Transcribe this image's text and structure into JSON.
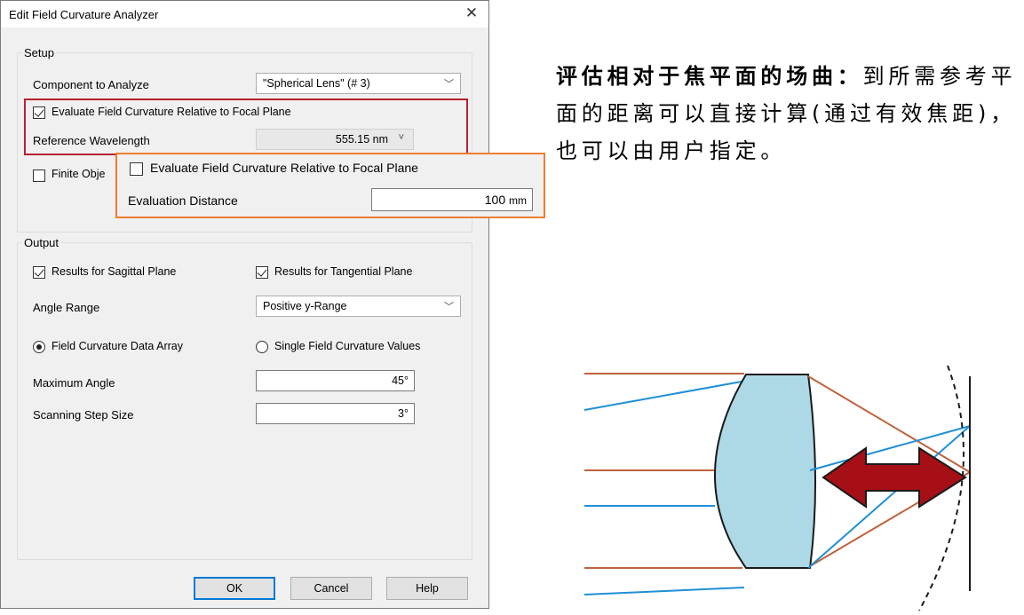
{
  "dialog": {
    "title": "Edit Field Curvature Analyzer",
    "close_glyph": "✕",
    "setup": {
      "legend": "Setup",
      "component_label": "Component to Analyze",
      "component_value": "\"Spherical Lens\" (# 3)",
      "eval_focal_label": "Evaluate Field Curvature Relative to Focal Plane",
      "eval_focal_checked": true,
      "ref_wavelength_label": "Reference Wavelength",
      "ref_wavelength_value": "555.15 nm",
      "finite_label": "Finite Obje",
      "finite_checked": false
    },
    "popup": {
      "eval_focal_label": "Evaluate Field Curvature Relative to Focal Plane",
      "eval_focal_checked": false,
      "distance_label": "Evaluation Distance",
      "distance_value": "100",
      "distance_unit": "mm"
    },
    "output": {
      "legend": "Output",
      "sagittal_label": "Results for Sagittal Plane",
      "sagittal_checked": true,
      "tangential_label": "Results for Tangential Plane",
      "tangential_checked": true,
      "angle_range_label": "Angle Range",
      "angle_range_value": "Positive y-Range",
      "data_array_label": "Field Curvature Data Array",
      "data_array_selected": true,
      "single_values_label": "Single Field Curvature Values",
      "single_values_selected": false,
      "max_angle_label": "Maximum Angle",
      "max_angle_value": "45°",
      "step_label": "Scanning Step Size",
      "step_value": "3°"
    },
    "buttons": {
      "ok": "OK",
      "cancel": "Cancel",
      "help": "Help"
    }
  },
  "description": {
    "bold": "评估相对于焦平面的场曲：",
    "rest": "到所需参考平面的距离可以直接计算(通过有效焦距)，也可以由用户指定。"
  },
  "colors": {
    "red_highlight": "#b5232f",
    "orange_highlight": "#ed7d31",
    "lens_fill": "#add8e6",
    "ray_blue": "#1f8fd6",
    "ray_orange": "#c0623c",
    "arrow_fill": "#a50f15"
  }
}
